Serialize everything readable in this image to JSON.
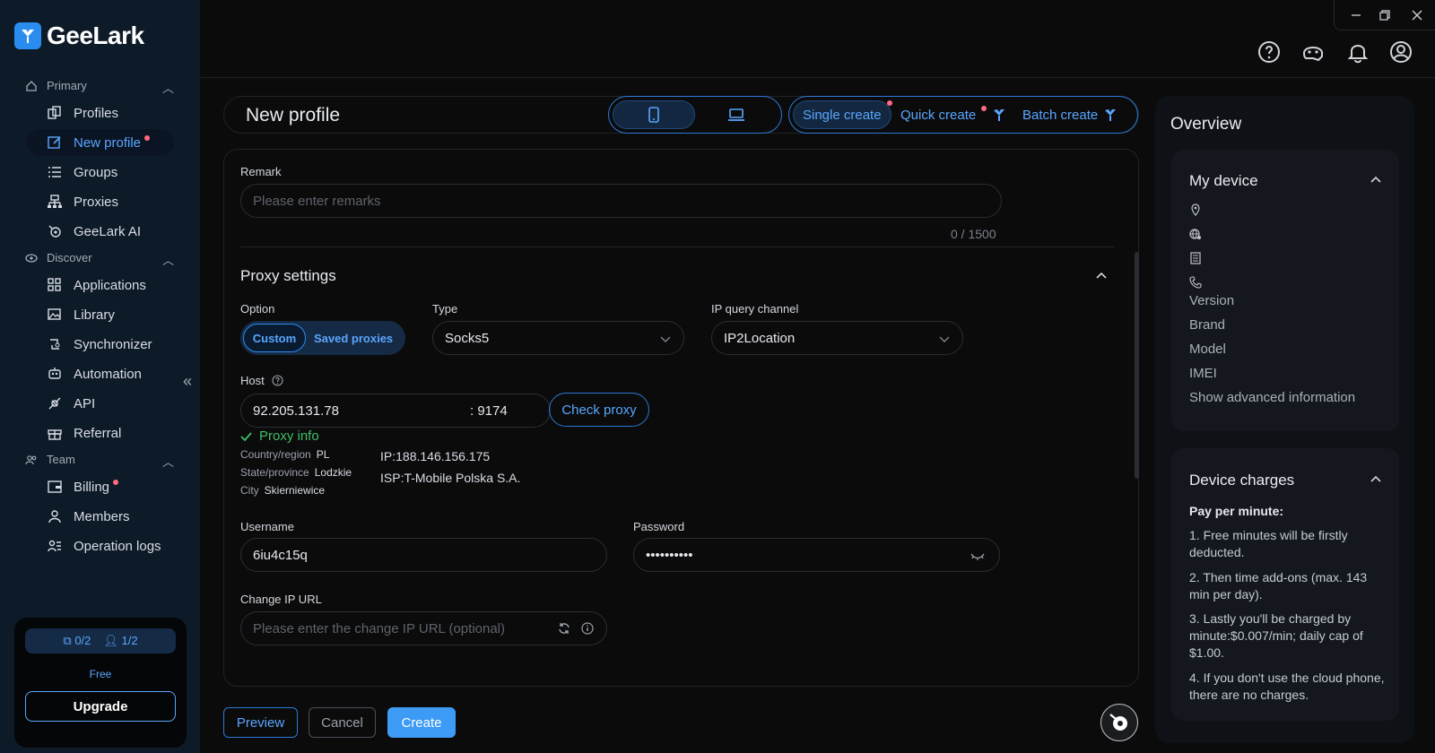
{
  "app": {
    "name": "GeeLark"
  },
  "sidebar": {
    "sections": [
      {
        "label": "Primary",
        "items": [
          "Profiles",
          "New profile",
          "Groups",
          "Proxies",
          "GeeLark AI"
        ]
      },
      {
        "label": "Discover",
        "items": [
          "Applications",
          "Library",
          "Synchronizer",
          "Automation",
          "API",
          "Referral"
        ]
      },
      {
        "label": "Team",
        "items": [
          "Billing",
          "Members",
          "Operation logs"
        ]
      }
    ],
    "active_item": "New profile",
    "plan": {
      "profiles": "0/2",
      "members": "1/2",
      "tier": "Free",
      "upgrade_label": "Upgrade"
    }
  },
  "header": {
    "title": "New profile",
    "modes": [
      "Single create",
      "Quick create",
      "Batch create"
    ]
  },
  "form": {
    "remark_label": "Remark",
    "remark_placeholder": "Please enter remarks",
    "remark_counter": "0 / 1500",
    "proxy_title": "Proxy settings",
    "option_label": "Option",
    "option_custom": "Custom",
    "option_saved": "Saved proxies",
    "type_label": "Type",
    "type_value": "Socks5",
    "ipq_label": "IP query channel",
    "ipq_value": "IP2Location",
    "host_label": "Host",
    "host_value": "92.205.131.78",
    "port_value": ": 9174",
    "check_label": "Check proxy",
    "proxy_info": {
      "title": "Proxy info",
      "country_label": "Country/region",
      "country": "PL",
      "state_label": "State/province",
      "state": "Lodzkie",
      "city_label": "City",
      "city": "Skierniewice",
      "ip": "IP:188.146.156.175",
      "isp": "ISP:T-Mobile Polska S.A."
    },
    "username_label": "Username",
    "username_value": "6iu4c15q",
    "password_label": "Password",
    "password_value": "••••••••••",
    "change_ip_label": "Change IP URL",
    "change_ip_placeholder": "Please enter the change IP URL (optional)"
  },
  "footer": {
    "preview": "Preview",
    "cancel": "Cancel",
    "create": "Create"
  },
  "overview": {
    "title": "Overview",
    "my_device": {
      "title": "My device",
      "fields": [
        "Version",
        "Brand",
        "Model",
        "IMEI",
        "Show advanced information"
      ]
    },
    "charges": {
      "title": "Device charges",
      "heading": "Pay per minute:",
      "items": [
        "1. Free minutes will be firstly deducted.",
        "2. Then time add-ons (max. 143 min per day).",
        "3. Lastly you'll be charged by minute:$0.007/min; daily cap of $1.00.",
        "4. If you don't use the cloud phone, there are no charges."
      ]
    }
  },
  "colors": {
    "accent": "#3d9bf5",
    "bg": "#0b0b0c",
    "sidebar": "#0d1a28",
    "success": "#3fbf68",
    "badge": "#ff6b81"
  },
  "icons": [
    "help-icon",
    "assistant-icon",
    "bell-icon",
    "user-icon",
    "minimize-icon",
    "restore-icon",
    "close-icon"
  ]
}
